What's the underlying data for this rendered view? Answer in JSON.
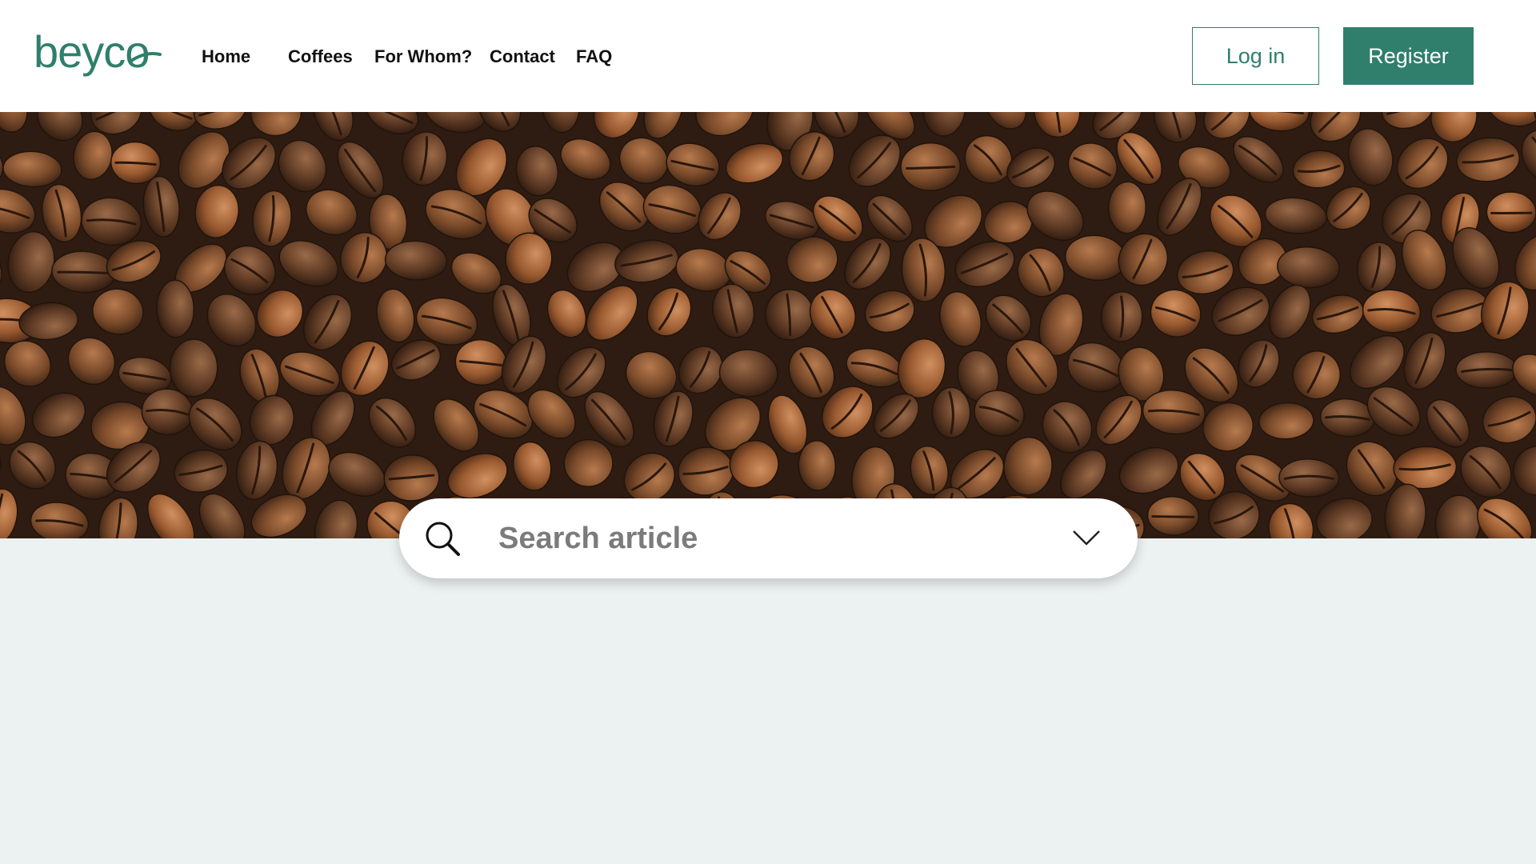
{
  "brand": {
    "logo_text": "beyco",
    "accent_color": "#2f7f6c"
  },
  "nav": {
    "items": [
      {
        "label": "Home"
      },
      {
        "label": "Coffees"
      },
      {
        "label": "For Whom?"
      },
      {
        "label": "Contact"
      },
      {
        "label": "FAQ"
      }
    ]
  },
  "auth": {
    "login_label": "Log in",
    "register_label": "Register"
  },
  "hero": {
    "image": "coffee-beans-photo"
  },
  "search": {
    "placeholder": "Search article",
    "value": "",
    "icon": "search-icon",
    "dropdown_icon": "chevron-down-icon"
  },
  "colors": {
    "page_background": "#ecf1f1",
    "header_background": "#ffffff",
    "register_button": "#2f7f6c"
  }
}
